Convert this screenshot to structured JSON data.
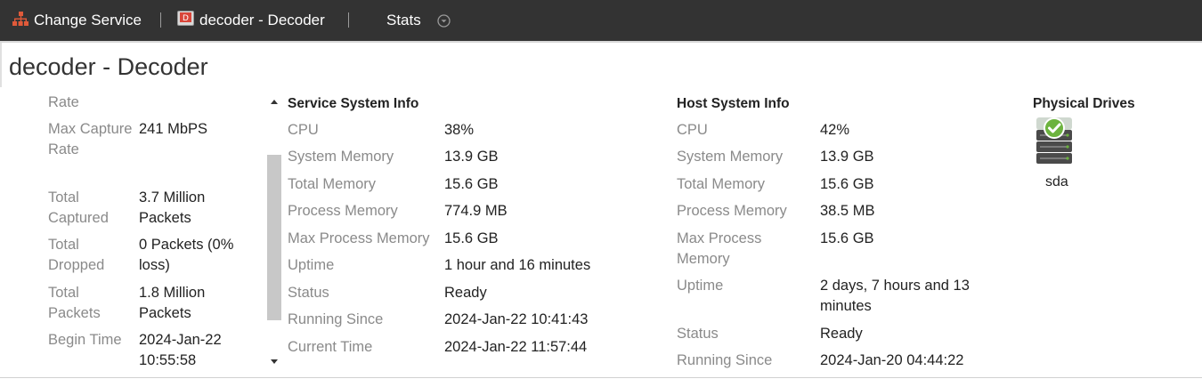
{
  "toolbar": {
    "change_service": "Change Service",
    "service_name": "decoder - Decoder",
    "view": "Stats"
  },
  "page": {
    "title": "decoder - Decoder"
  },
  "capture_stats": [
    {
      "label": "Rate",
      "value": ""
    },
    {
      "label": "Max Capture Rate",
      "value": "241 MbPS"
    },
    {
      "label": "Total Captured",
      "value": "3.7 Million Packets"
    },
    {
      "label": "Total Dropped",
      "value": "0 Packets (0% loss)"
    },
    {
      "label": "Total Packets",
      "value": "1.8 Million Packets"
    },
    {
      "label": "Begin Time",
      "value": "2024-Jan-22 10:55:58"
    }
  ],
  "service_system_info": {
    "heading": "Service System Info",
    "rows": [
      {
        "label": "CPU",
        "value": "38%"
      },
      {
        "label": "System Memory",
        "value": "13.9 GB"
      },
      {
        "label": "Total Memory",
        "value": "15.6 GB"
      },
      {
        "label": "Process Memory",
        "value": "774.9 MB"
      },
      {
        "label": "Max Process Memory",
        "value": "15.6 GB"
      },
      {
        "label": "Uptime",
        "value": "1 hour and 16 minutes"
      },
      {
        "label": "Status",
        "value": "Ready"
      },
      {
        "label": "Running Since",
        "value": "2024-Jan-22 10:41:43"
      },
      {
        "label": "Current Time",
        "value": "2024-Jan-22 11:57:44"
      }
    ]
  },
  "host_system_info": {
    "heading": "Host System Info",
    "rows": [
      {
        "label": "CPU",
        "value": "42%"
      },
      {
        "label": "System Memory",
        "value": "13.9 GB"
      },
      {
        "label": "Total Memory",
        "value": "15.6 GB"
      },
      {
        "label": "Process Memory",
        "value": "38.5 MB"
      },
      {
        "label": "Max Process Memory",
        "value": "15.6 GB"
      },
      {
        "label": "Uptime",
        "value": "2 days, 7 hours and 13 minutes"
      },
      {
        "label": "Status",
        "value": "Ready"
      },
      {
        "label": "Running Since",
        "value": "2024-Jan-20 04:44:22"
      }
    ]
  },
  "physical_drives": {
    "heading": "Physical Drives",
    "drives": [
      {
        "name": "sda",
        "icon": "drive-ok-icon"
      }
    ]
  },
  "colors": {
    "toolbar_bg": "#333333",
    "label_gray": "#8a8a8a",
    "ok_green": "#6cb33e"
  }
}
